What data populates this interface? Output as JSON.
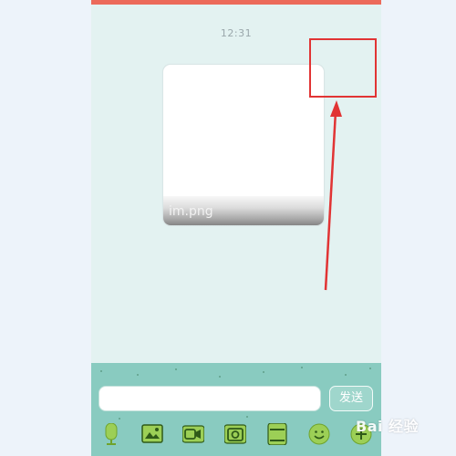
{
  "chat": {
    "timestamp": "12:31",
    "image_message": {
      "file_name": "im.png"
    }
  },
  "composer": {
    "input_value": "",
    "input_placeholder": "",
    "send_label": "发送"
  },
  "toolbar": {
    "icons": [
      "microphone-icon",
      "image-icon",
      "video-icon",
      "camera-icon",
      "file-icon",
      "emoji-icon",
      "add-icon"
    ]
  },
  "annotation": {
    "color": "#e13434"
  },
  "watermark": {
    "text": "Bai 经验"
  },
  "colors": {
    "top_bar": "#ec6a5a",
    "chat_background": "#e3f2f1",
    "input_area": "#89cbc0",
    "icon_fill": "#9ccf56",
    "icon_dark": "#2f5a18"
  }
}
